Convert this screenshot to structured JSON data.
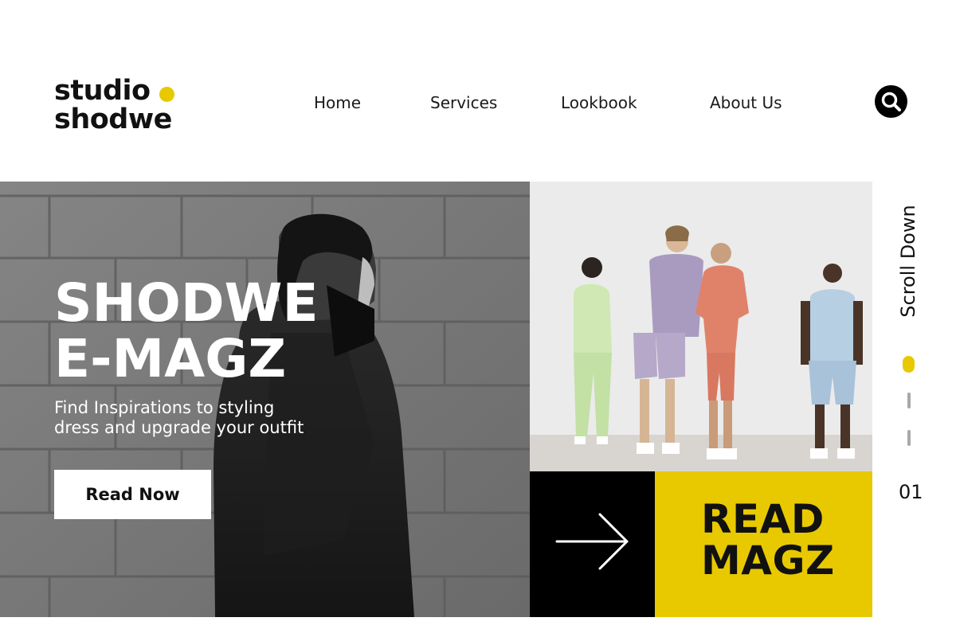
{
  "header": {
    "logo": {
      "line1": "studio",
      "line2": "shodwe"
    },
    "nav": [
      {
        "label": "Home"
      },
      {
        "label": "Services"
      },
      {
        "label": "Lookbook"
      },
      {
        "label": "About Us"
      }
    ],
    "search_icon": "search-icon"
  },
  "hero": {
    "title_line1": "SHODWE",
    "title_line2": "E-MAGZ",
    "subtitle_line1": "Find Inspirations to styling",
    "subtitle_line2": "dress and upgrade your outfit",
    "cta_label": "Read Now"
  },
  "feature": {
    "arrow_icon": "arrow-right-icon",
    "magz_line1": "READ",
    "magz_line2": "MAGZ"
  },
  "rail": {
    "scroll_label": "Scroll Down",
    "slide_number": "01",
    "active_slide": 1,
    "slide_count": 3
  },
  "colors": {
    "accent": "#e8c900",
    "dark": "#000000",
    "background": "#ffffff"
  }
}
